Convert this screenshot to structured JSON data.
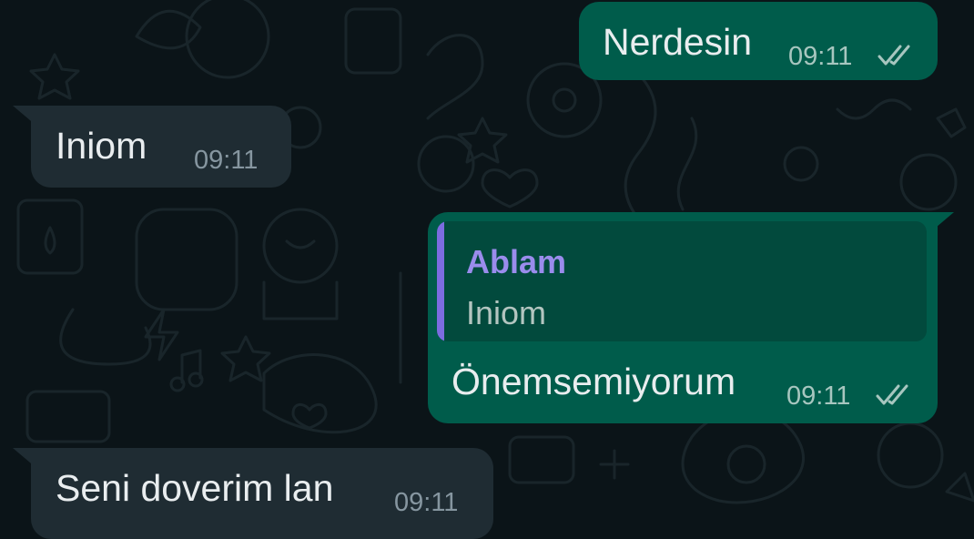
{
  "messages": [
    {
      "direction": "outgoing",
      "text": "Nerdesin",
      "time": "09:11",
      "status_icon": "double-check-icon"
    },
    {
      "direction": "incoming",
      "text": "Iniom",
      "time": "09:11"
    },
    {
      "direction": "outgoing",
      "reply": {
        "author": "Ablam",
        "text": "Iniom"
      },
      "text": "Önemsemiyorum",
      "time": "09:11",
      "status_icon": "double-check-icon"
    },
    {
      "direction": "incoming",
      "text": "Seni doverim lan",
      "time": "09:11"
    }
  ],
  "colors": {
    "background": "#0b1418",
    "incoming_bubble": "#1f2c33",
    "outgoing_bubble": "#005c4b",
    "quote_accent": "#7c6ce0"
  }
}
